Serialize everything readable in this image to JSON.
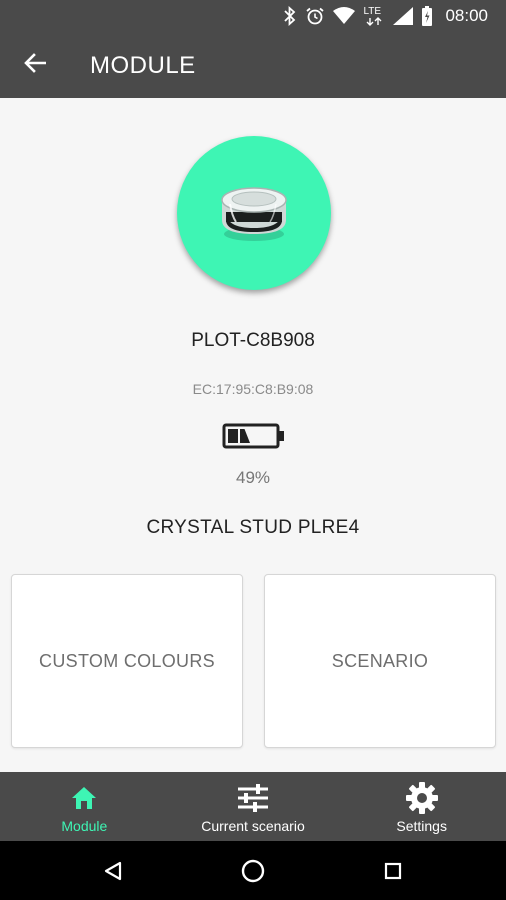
{
  "status_bar": {
    "time": "08:00",
    "network_label": "LTE",
    "icons": [
      "bluetooth-icon",
      "alarm-icon",
      "wifi-icon",
      "lte-icon",
      "signal-icon",
      "battery-icon"
    ]
  },
  "app_bar": {
    "title": "MODULE",
    "back_icon": "arrow-left-icon"
  },
  "device": {
    "name": "PLOT-C8B908",
    "mac": "EC:17:95:C8:B9:08",
    "battery_percent": 49,
    "battery_text": "49%",
    "product": "CRYSTAL STUD PLRE4",
    "avatar_color": "#3ef5b4"
  },
  "cards": {
    "custom_colours": "CUSTOM COLOURS",
    "scenario": "SCENARIO"
  },
  "bottom_nav": {
    "items": [
      {
        "label": "Module",
        "icon": "home-icon",
        "active": true
      },
      {
        "label": "Current scenario",
        "icon": "sliders-icon",
        "active": false
      },
      {
        "label": "Settings",
        "icon": "gear-icon",
        "active": false
      }
    ]
  },
  "system_nav": {
    "icons": [
      "back-triangle-icon",
      "home-circle-icon",
      "recents-square-icon"
    ]
  },
  "colors": {
    "bar": "#4a4a4a",
    "accent": "#3ef5b4",
    "background": "#f6f6f6"
  }
}
